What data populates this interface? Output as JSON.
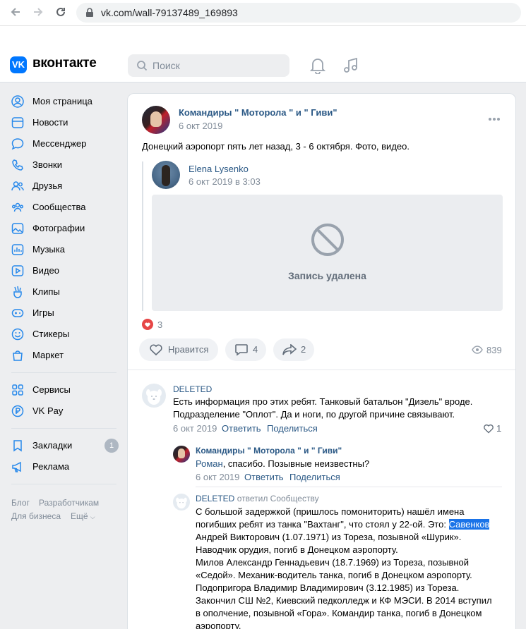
{
  "browser": {
    "url": "vk.com/wall-79137489_169893"
  },
  "header": {
    "logo_letter": "VK",
    "brand": "вконтакте",
    "search_placeholder": "Поиск"
  },
  "sidebar": {
    "items": [
      {
        "label": "Моя страница",
        "icon": "user-circle-icon"
      },
      {
        "label": "Новости",
        "icon": "news-icon"
      },
      {
        "label": "Мессенджер",
        "icon": "message-icon"
      },
      {
        "label": "Звонки",
        "icon": "phone-icon"
      },
      {
        "label": "Друзья",
        "icon": "friends-icon"
      },
      {
        "label": "Сообщества",
        "icon": "communities-icon"
      },
      {
        "label": "Фотографии",
        "icon": "photo-icon"
      },
      {
        "label": "Музыка",
        "icon": "music-icon"
      },
      {
        "label": "Видео",
        "icon": "video-icon"
      },
      {
        "label": "Клипы",
        "icon": "clips-icon"
      },
      {
        "label": "Игры",
        "icon": "gamepad-icon"
      },
      {
        "label": "Стикеры",
        "icon": "smile-icon"
      },
      {
        "label": "Маркет",
        "icon": "bag-icon"
      }
    ],
    "items2": [
      {
        "label": "Сервисы",
        "icon": "services-icon"
      },
      {
        "label": "VK Pay",
        "icon": "vkpay-icon"
      }
    ],
    "items3": [
      {
        "label": "Закладки",
        "icon": "bookmark-icon",
        "count": "1"
      },
      {
        "label": "Реклама",
        "icon": "megaphone-icon"
      }
    ],
    "footer": {
      "blog": "Блог",
      "developers": "Разработчикам",
      "business": "Для бизнеса",
      "more": "Ещё"
    }
  },
  "post": {
    "author": "Командиры \" Моторола \" и \" Гиви\"",
    "date": "6 окт 2019",
    "text": "Донецкий аэропорт пять лет назад, 3 - 6 октября. Фото, видео.",
    "repost": {
      "author": "Elena Lysenko",
      "date": "6 окт 2019 в 3:03",
      "deleted_text": "Запись удалена"
    },
    "reactions_count": "3",
    "like_label": "Нравится",
    "comments_count": "4",
    "shares_count": "2",
    "views": "839"
  },
  "comments": [
    {
      "author": "DELETED",
      "lines": [
        "Есть информация про этих ребят. Танковый батальон \"Дизель\" вроде.",
        "Подразделение \"Оплот\". Да и ноги, по другой причине связывают."
      ],
      "date": "6 окт 2019",
      "reply": "Ответить",
      "share": "Поделиться",
      "likes": "1"
    },
    {
      "author": "Командиры \" Моторола \" и \" Гиви\"",
      "addressee": "Роман",
      "text": ", спасибо. Позывные неизвестны?",
      "date": "6 окт 2019",
      "reply": "Ответить",
      "share": "Поделиться"
    },
    {
      "author": "DELETED",
      "replied": "ответил Сообществу",
      "line1": "С большой задержкой (пришлось помониторить) нашёл имена",
      "line2_before": "погибших ребят из танка \"Вахтанг\", что стоял у 22-ой. Это: ",
      "line2_highlight": "Савенков",
      "lines_rest": [
        "Андрей Викторович (1.07.1971) из Тореза, позывной «Шурик».",
        "Наводчик орудия, погиб в Донецком аэропорту.",
        "Милов Александр Геннадьевич (18.7.1969) из Тореза, позывной",
        "«Седой». Механик-водитель танка, погиб в Донецком аэропорту.",
        "Подопригора Владимир Владимирович (3.12.1985) из Тореза.",
        "Закончил СШ №2, Киевский педколледж и КФ МЭСИ. В 2014 вступил",
        "в ополчение, позывной «Гора». Командир танка, погиб в Донецком",
        "аэропорту."
      ]
    }
  ],
  "colors": {
    "accent": "#2a5885",
    "vk_blue": "#0077ff",
    "highlight": "#1a73e8",
    "like_red": "#e64646"
  }
}
